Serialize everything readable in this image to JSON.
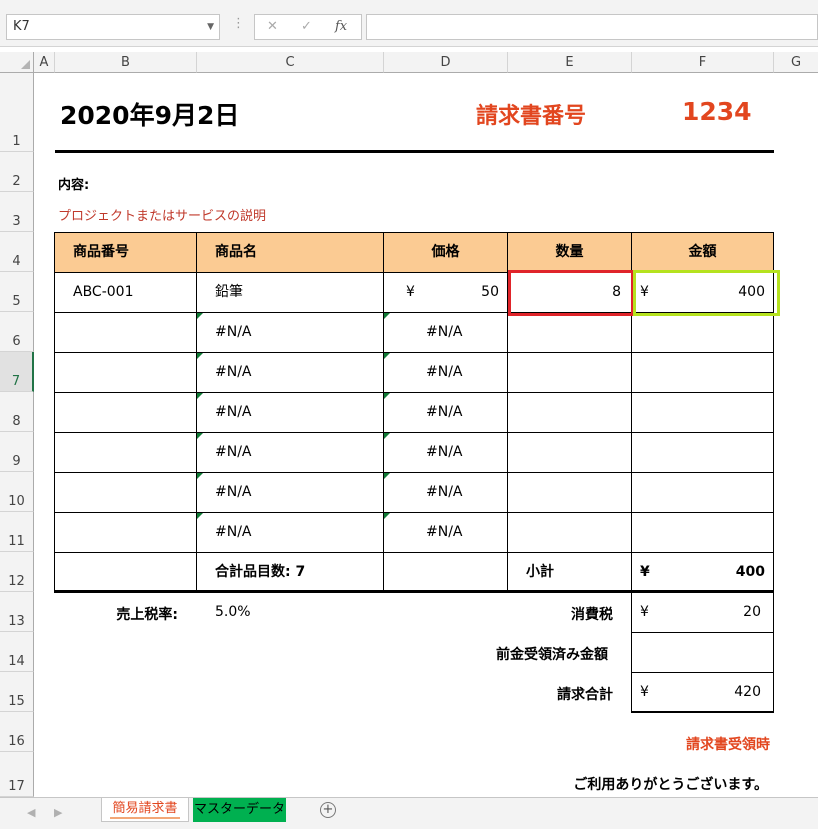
{
  "formula_bar": {
    "name_box": "K7",
    "cancel_icon": "✕",
    "enter_icon": "✓",
    "fx_label": "fx"
  },
  "columns": [
    "A",
    "B",
    "C",
    "D",
    "E",
    "F",
    "G"
  ],
  "rows": [
    "1",
    "2",
    "3",
    "4",
    "5",
    "6",
    "7",
    "8",
    "9",
    "10",
    "11",
    "12",
    "13",
    "14",
    "15",
    "16",
    "17"
  ],
  "selected_row": "7",
  "invoice": {
    "date": "2020年9月2日",
    "number_label": "請求書番号",
    "number": "1234",
    "content_label": "内容:",
    "description": "プロジェクトまたはサービスの説明",
    "headers": [
      "商品番号",
      "商品名",
      "価格",
      "数量",
      "金額"
    ],
    "first_item": {
      "code": "ABC-001",
      "name": "鉛筆",
      "price_currency": "¥",
      "price": "50",
      "qty": "8",
      "amount_currency": "¥",
      "amount": "400"
    },
    "na_rows": [
      {
        "name": "#N/A",
        "price": "#N/A"
      },
      {
        "name": "#N/A",
        "price": "#N/A"
      },
      {
        "name": "#N/A",
        "price": "#N/A"
      },
      {
        "name": "#N/A",
        "price": "#N/A"
      },
      {
        "name": "#N/A",
        "price": "#N/A"
      },
      {
        "name": "#N/A",
        "price": "#N/A"
      }
    ],
    "total_items": "合計品目数: 7",
    "subtotal_label": "小計",
    "subtotal_currency": "¥",
    "subtotal": "400",
    "tax_rate_label": "売上税率:",
    "tax_rate": "5.0%",
    "tax_label": "消費税",
    "tax_currency": "¥",
    "tax": "20",
    "prepaid_label": "前金受領済み金額",
    "grand_total_label": "請求合計",
    "grand_total_currency": "¥",
    "grand_total": "420",
    "receipt_note": "請求書受領時",
    "thanks": "ご利用ありがとうございます。"
  },
  "sheet_tabs": [
    "簡易請求書",
    "マスターデータ"
  ],
  "colors": {
    "accent_red": "#e2461f",
    "header_fill": "#fbcb93",
    "selection_red": "#e0242a",
    "selection_green": "#b5e21e",
    "tab_green": "#00b050",
    "excel_green": "#217346"
  }
}
